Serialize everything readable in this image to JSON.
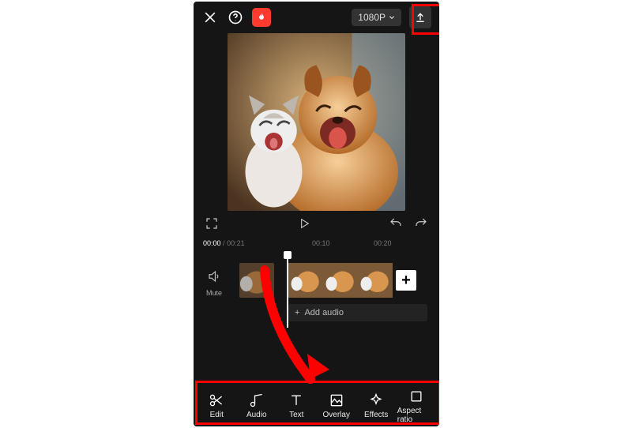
{
  "topbar": {
    "resolution_label": "1080P"
  },
  "controls": {
    "current_time": "00:00",
    "total_time": "00:21",
    "ruler_marks": [
      "00:00",
      "00:10",
      "00:20"
    ]
  },
  "timeline": {
    "mute_label": "Mute",
    "add_audio_label": "Add audio",
    "add_clip_glyph": "+"
  },
  "tools": [
    {
      "id": "edit",
      "label": "Edit"
    },
    {
      "id": "audio",
      "label": "Audio"
    },
    {
      "id": "text",
      "label": "Text"
    },
    {
      "id": "overlay",
      "label": "Overlay"
    },
    {
      "id": "effects",
      "label": "Effects"
    },
    {
      "id": "aspect",
      "label": "Aspect ratio"
    }
  ]
}
